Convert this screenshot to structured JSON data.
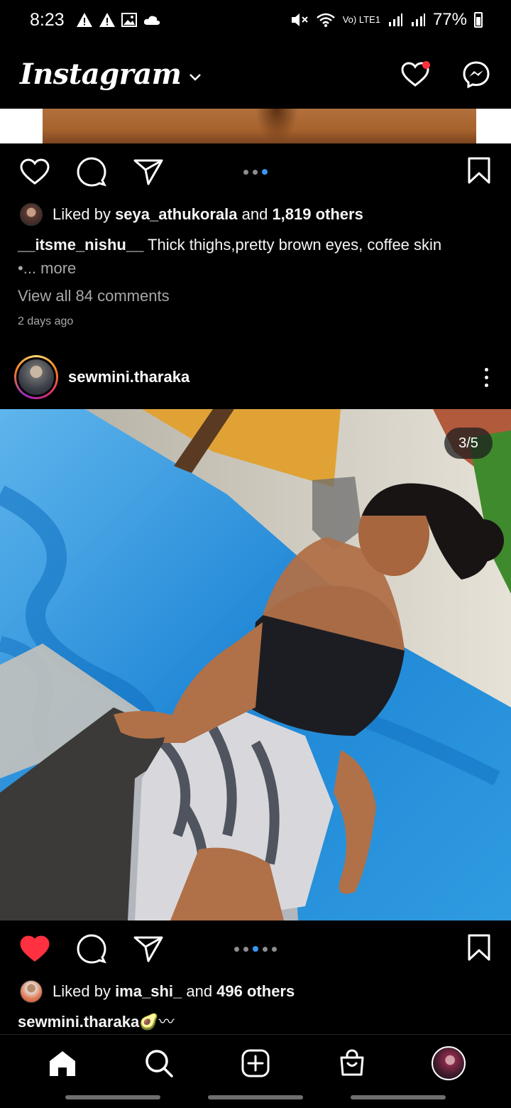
{
  "status_bar": {
    "time": "8:23",
    "left_icons": [
      "warning-icon",
      "warning-icon",
      "image-icon",
      "cloud-icon"
    ],
    "network": "Vo) LTE1",
    "battery": "77%"
  },
  "header": {
    "logo_text": "Instagram",
    "caret": "⌄"
  },
  "prev_post": {
    "liked_prefix": "Liked by ",
    "liked_user": "seya_athukorala",
    "liked_and": " and ",
    "liked_others": "1,819 others",
    "caption_user": "__itsme_nishu__",
    "caption_text": " Thick thighs,pretty brown eyes, coffee skin",
    "caption_more": "•... more",
    "view_comments": "View all 84 comments",
    "time_ago": "2 days ago",
    "carousel_total": 3,
    "carousel_active_index": 3
  },
  "post": {
    "username": "sewmini.tharaka",
    "image_counter": "3/5",
    "carousel_total": 5,
    "carousel_active_index": 3,
    "liked": true,
    "liked_prefix": "Liked by ",
    "liked_user": "ima_shi_",
    "liked_and": " and ",
    "liked_others": "496 others",
    "caption_user": "sewmini.tharaka",
    "caption_emoji": "🥑〰"
  },
  "nav": {
    "items": [
      "home-icon",
      "search-icon",
      "new-post-icon",
      "shop-icon",
      "profile-avatar"
    ]
  },
  "colors": {
    "background": "#000000",
    "like_red": "#ff3040",
    "carousel_blue": "#3897f0",
    "muted_text": "#a8a8a8"
  }
}
